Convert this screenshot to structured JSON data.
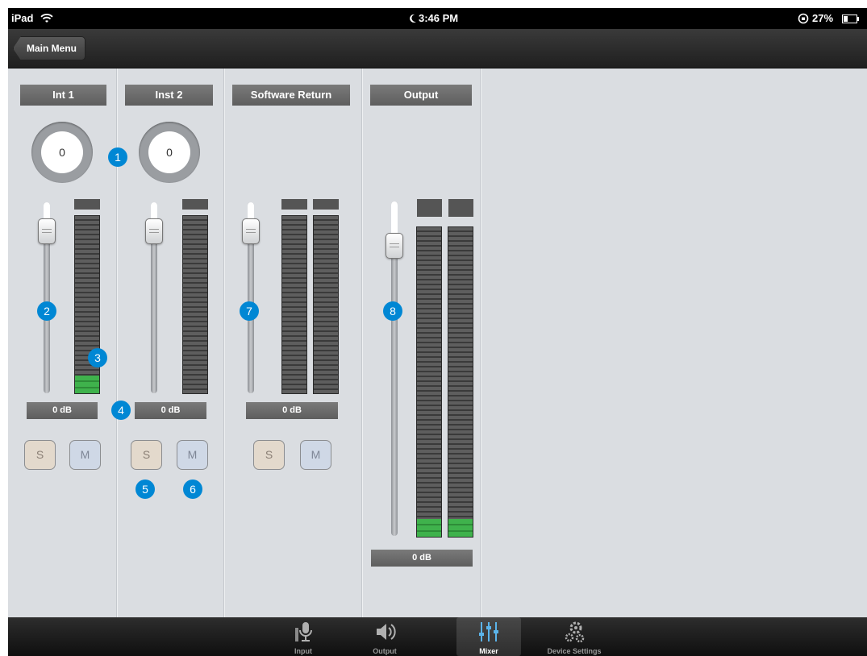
{
  "status_bar": {
    "device": "iPad",
    "time": "3:46 PM",
    "battery": "27%"
  },
  "nav": {
    "back_label": "Main Menu"
  },
  "channels": [
    {
      "name": "Int 1",
      "knob_value": "0",
      "gain": "0 dB",
      "solo": "S",
      "mute": "M"
    },
    {
      "name": "Inst 2",
      "knob_value": "0",
      "gain": "0 dB",
      "solo": "S",
      "mute": "M"
    },
    {
      "name": "Software Return",
      "gain": "0 dB",
      "solo": "S",
      "mute": "M"
    },
    {
      "name": "Output",
      "gain": "0 dB"
    }
  ],
  "callouts": [
    "1",
    "2",
    "3",
    "4",
    "5",
    "6",
    "7",
    "8"
  ],
  "tabs": [
    {
      "label": "Input",
      "icon": "microphone-icon"
    },
    {
      "label": "Output",
      "icon": "speaker-icon"
    },
    {
      "label": "Mixer",
      "icon": "mixer-sliders-icon",
      "active": true
    },
    {
      "label": "Device Settings",
      "icon": "gears-icon"
    }
  ],
  "colors": {
    "accent": "#0087d4",
    "meter_green": "#3fb24c",
    "background": "#dadde1"
  }
}
